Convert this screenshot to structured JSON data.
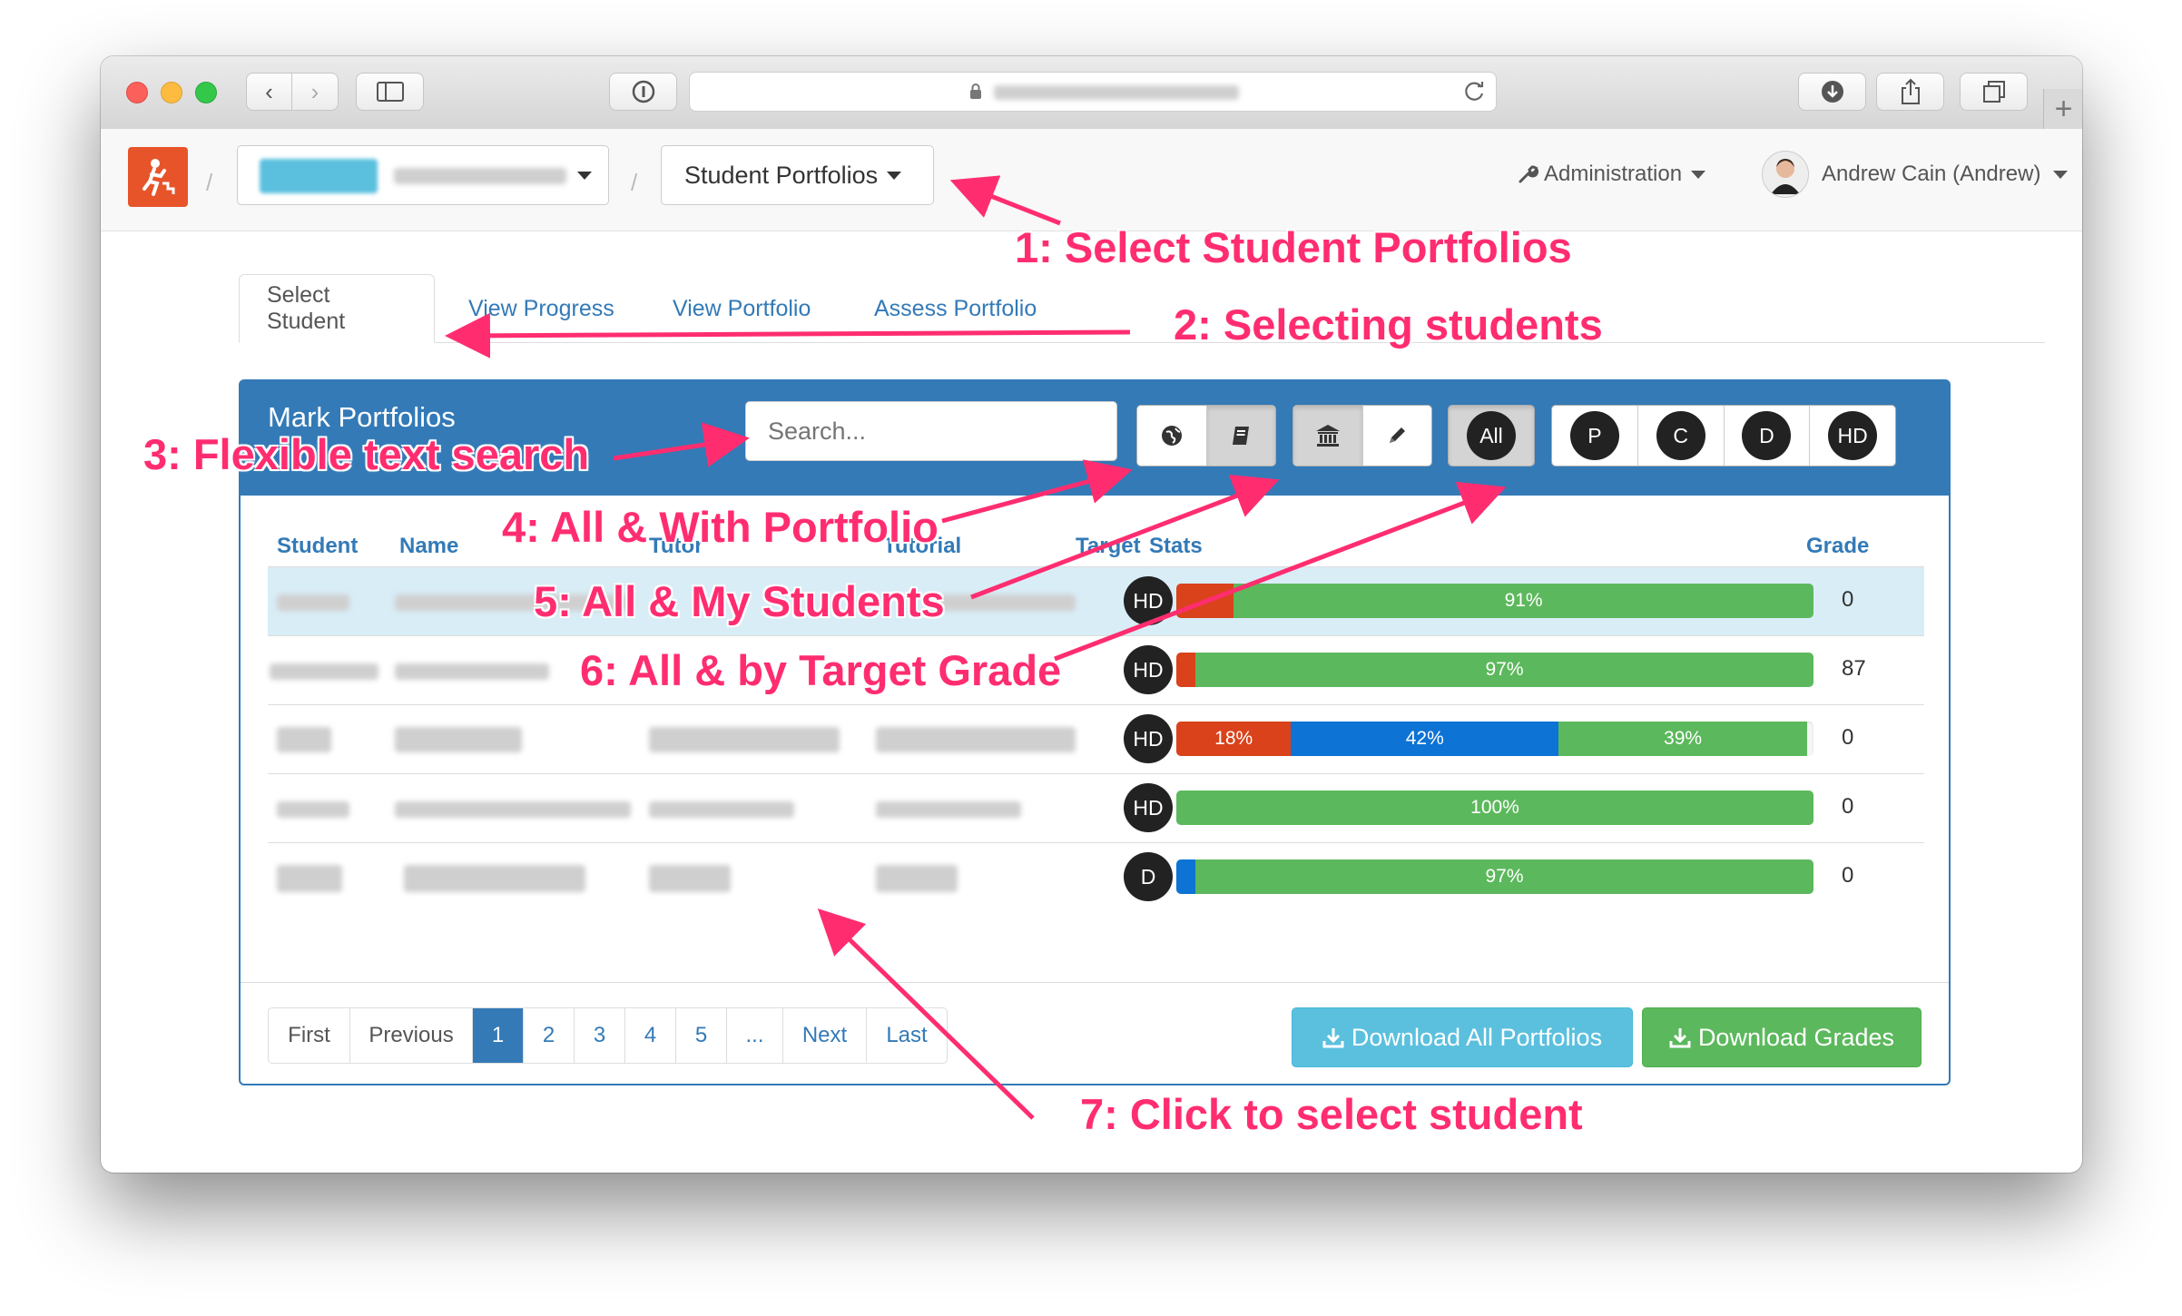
{
  "browser": {
    "icons": [
      "back-icon",
      "forward-icon",
      "sidebar-icon",
      "info-icon",
      "lock-icon",
      "reload-icon",
      "download-icon",
      "share-icon",
      "tabs-icon",
      "new-tab-icon"
    ]
  },
  "nav": {
    "breadcrumb_current": "Student Portfolios",
    "admin_label": "Administration",
    "user_label": "Andrew Cain (Andrew)"
  },
  "tabs": [
    {
      "label": "Select Student",
      "active": true
    },
    {
      "label": "View Progress"
    },
    {
      "label": "View Portfolio"
    },
    {
      "label": "Assess Portfolio"
    }
  ],
  "panel": {
    "title": "Mark Portfolios",
    "search_placeholder": "Search...",
    "grade_filters": [
      "All",
      "P",
      "C",
      "D",
      "HD"
    ]
  },
  "table": {
    "headers": {
      "student": "Student",
      "name": "Name",
      "tutor": "Tutor",
      "tutorial": "Tutorial",
      "target": "Target",
      "stats": "Stats",
      "grade": "Grade"
    },
    "rows": [
      {
        "target": "HD",
        "stats": [
          {
            "color": "red",
            "pct": 9
          },
          {
            "color": "green",
            "pct": 91,
            "label": "91%"
          }
        ],
        "grade": "0"
      },
      {
        "target": "HD",
        "stats": [
          {
            "color": "red",
            "pct": 3
          },
          {
            "color": "green",
            "pct": 97,
            "label": "97%"
          }
        ],
        "grade": "87"
      },
      {
        "target": "HD",
        "stats": [
          {
            "color": "red",
            "pct": 18,
            "label": "18%"
          },
          {
            "color": "blue",
            "pct": 42,
            "label": "42%"
          },
          {
            "color": "green",
            "pct": 39,
            "label": "39%"
          }
        ],
        "grade": "0"
      },
      {
        "target": "HD",
        "stats": [
          {
            "color": "green",
            "pct": 100,
            "label": "100%"
          }
        ],
        "grade": "0"
      },
      {
        "target": "D",
        "stats": [
          {
            "color": "blue",
            "pct": 3
          },
          {
            "color": "green",
            "pct": 97,
            "label": "97%"
          }
        ],
        "grade": "0"
      }
    ]
  },
  "pagination": {
    "first": "First",
    "previous": "Previous",
    "pages": [
      "1",
      "2",
      "3",
      "4",
      "5",
      "..."
    ],
    "current": "1",
    "next": "Next",
    "last": "Last"
  },
  "actions": {
    "download_portfolios": "Download All Portfolios",
    "download_grades": "Download Grades"
  },
  "annotations": [
    "1: Select Student Portfolios",
    "2: Selecting students",
    "3: Flexible text search",
    "4: All & With Portfolio",
    "5: All & My Students",
    "6: All & by Target Grade",
    "7: Click to select student"
  ],
  "colors": {
    "accent": "#337ab7",
    "annotation": "#ff2d70",
    "success": "#5cb85c",
    "danger": "#d9421b",
    "info": "#5bc0de"
  }
}
